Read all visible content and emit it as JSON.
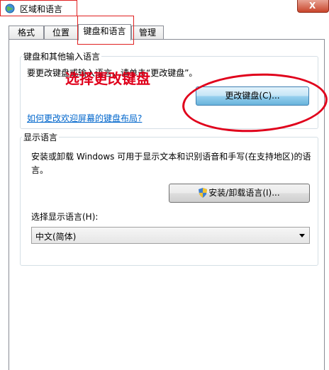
{
  "window": {
    "title": "区域和语言",
    "close_label": "X"
  },
  "tabs": [
    {
      "label": "格式"
    },
    {
      "label": "位置"
    },
    {
      "label": "键盘和语言"
    },
    {
      "label": "管理"
    }
  ],
  "active_tab": "键盘和语言",
  "keyboards": {
    "legend": "键盘和其他输入语言",
    "description": "要更改键盘或输入语言，请单击“更改键盘”。",
    "change_button": "更改键盘(C)...",
    "welcome_link": "如何更改欢迎屏幕的键盘布局?"
  },
  "display_language": {
    "legend": "显示语言",
    "description_line1": "安装或卸载 Windows 可用于显示文本和识别语音和手写(在支持地区)的语",
    "description_line2": "言。",
    "install_button": "安装/卸载语言(I)...",
    "select_label": "选择显示语言(H):",
    "select_value": "中文(简体)"
  },
  "annotation": {
    "text": "选择更改键盘",
    "color": "#e0001b"
  },
  "icons": [
    "globe-icon",
    "shield-icon",
    "dropdown-arrow-icon"
  ]
}
